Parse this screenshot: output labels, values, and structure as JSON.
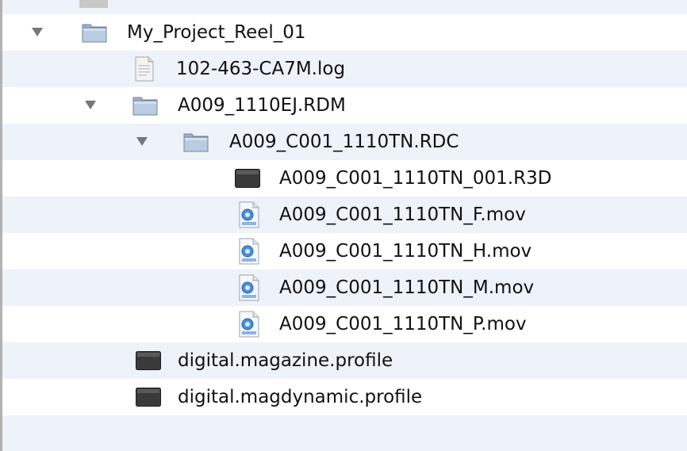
{
  "tree": {
    "rows": [
      {
        "label": "My_Project_Reel_01",
        "icon": "folder-icon",
        "expanded": true
      },
      {
        "label": "102-463-CA7M.log",
        "icon": "document-icon"
      },
      {
        "label": "A009_1110EJ.RDM",
        "icon": "folder-icon",
        "expanded": true
      },
      {
        "label": "A009_C001_1110TN.RDC",
        "icon": "folder-icon",
        "expanded": true
      },
      {
        "label": "A009_C001_1110TN_001.R3D",
        "icon": "r3d-file-icon"
      },
      {
        "label": "A009_C001_1110TN_F.mov",
        "icon": "quicktime-file-icon"
      },
      {
        "label": "A009_C001_1110TN_H.mov",
        "icon": "quicktime-file-icon"
      },
      {
        "label": "A009_C001_1110TN_M.mov",
        "icon": "quicktime-file-icon"
      },
      {
        "label": "A009_C001_1110TN_P.mov",
        "icon": "quicktime-file-icon"
      },
      {
        "label": "digital.magazine.profile",
        "icon": "profile-file-icon"
      },
      {
        "label": "digital.magdynamic.profile",
        "icon": "profile-file-icon"
      }
    ]
  }
}
